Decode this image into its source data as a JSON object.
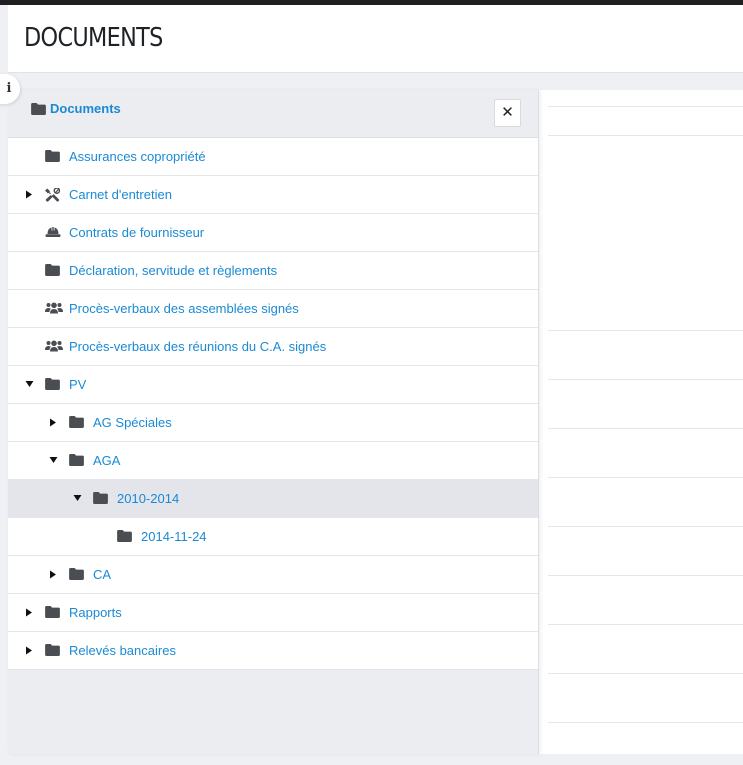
{
  "page": {
    "title": "DOCUMENTS"
  },
  "info_button": {
    "label": "i"
  },
  "tree": {
    "title": "Documents",
    "close_label": "✕",
    "items": [
      {
        "label": "Assurances copropriété",
        "icon": "folder-icon",
        "level": 0,
        "caret": "none",
        "selected": false
      },
      {
        "label": "Carnet d'entretien",
        "icon": "tools-icon",
        "level": 0,
        "caret": "collapsed",
        "selected": false
      },
      {
        "label": "Contrats de fournisseur",
        "icon": "hard-hat-icon",
        "level": 0,
        "caret": "none",
        "selected": false
      },
      {
        "label": "Déclaration, servitude et règlements",
        "icon": "folder-icon",
        "level": 0,
        "caret": "none",
        "selected": false
      },
      {
        "label": "Procès-verbaux des assemblées signés",
        "icon": "users-icon",
        "level": 0,
        "caret": "none",
        "selected": false
      },
      {
        "label": "Procès-verbaux des réunions du C.A. signés",
        "icon": "users-icon",
        "level": 0,
        "caret": "none",
        "selected": false
      },
      {
        "label": "PV",
        "icon": "folder-icon",
        "level": 0,
        "caret": "expanded",
        "selected": false
      },
      {
        "label": "AG Spéciales",
        "icon": "folder-icon",
        "level": 1,
        "caret": "collapsed",
        "selected": false
      },
      {
        "label": "AGA",
        "icon": "folder-icon",
        "level": 1,
        "caret": "expanded",
        "selected": false
      },
      {
        "label": "2010-2014",
        "icon": "folder-icon",
        "level": 2,
        "caret": "expanded",
        "selected": true
      },
      {
        "label": "2014-11-24",
        "icon": "folder-icon",
        "level": 3,
        "caret": "none",
        "selected": false
      },
      {
        "label": "CA",
        "icon": "folder-icon",
        "level": 1,
        "caret": "collapsed",
        "selected": false
      },
      {
        "label": "Rapports",
        "icon": "folder-icon",
        "level": 0,
        "caret": "collapsed",
        "selected": false
      },
      {
        "label": "Relevés bancaires",
        "icon": "folder-icon",
        "level": 0,
        "caret": "collapsed",
        "selected": false
      }
    ]
  },
  "colors": {
    "link": "#1a8ad4",
    "icon": "#4a4d52",
    "selected_row": "#e3e5ea",
    "panel_bg": "#ebedf0"
  }
}
